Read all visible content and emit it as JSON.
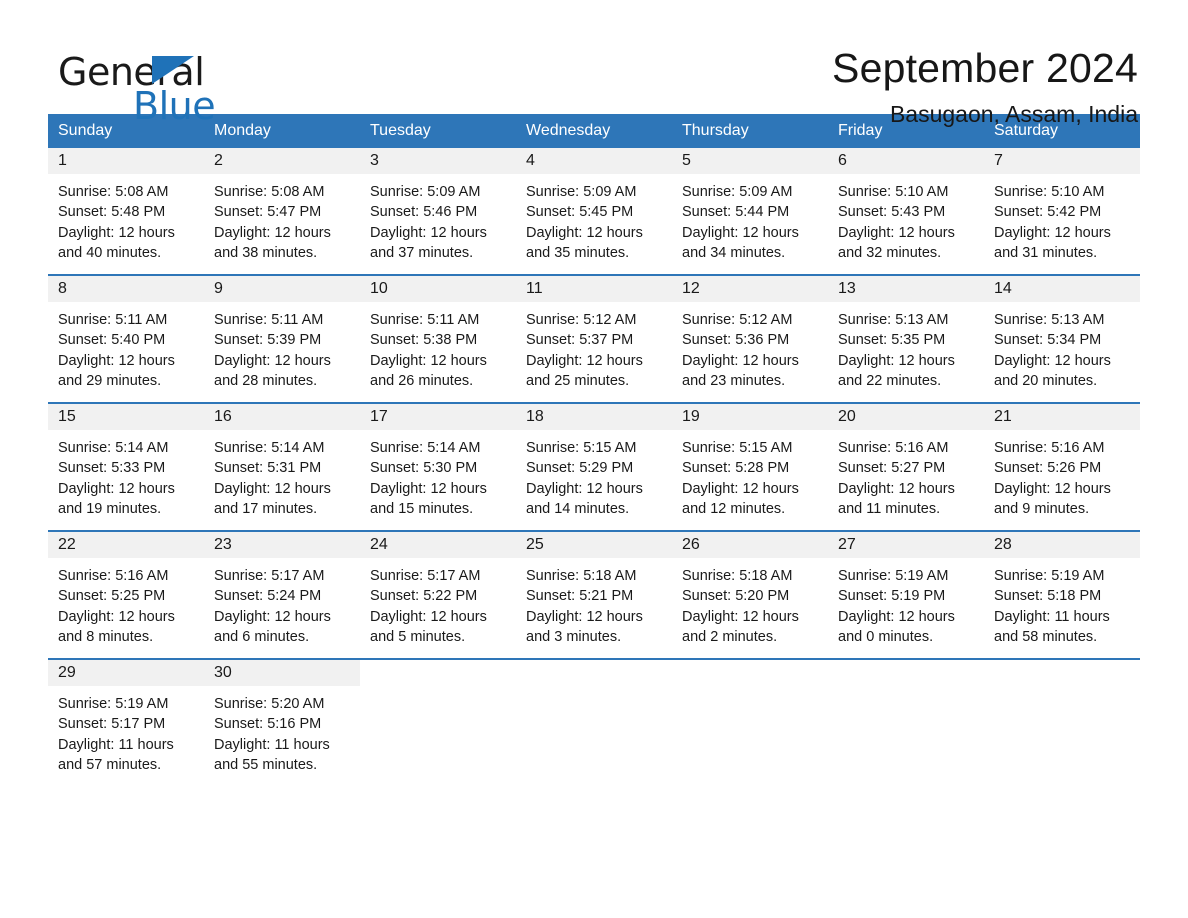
{
  "brand": {
    "name_part1": "General",
    "name_part2": "Blue",
    "triangle_color": "#1f72b8"
  },
  "header": {
    "title": "September 2024",
    "location": "Basugaon, Assam, India"
  },
  "theme": {
    "header_bg": "#2e76b8",
    "header_text": "#ffffff",
    "daynum_band": "#f1f1f1",
    "row_divider": "#2e76b8",
    "body_text": "#1a1a1a"
  },
  "weekdays": [
    "Sunday",
    "Monday",
    "Tuesday",
    "Wednesday",
    "Thursday",
    "Friday",
    "Saturday"
  ],
  "weeks": [
    [
      {
        "day": "1",
        "sunrise": "Sunrise: 5:08 AM",
        "sunset": "Sunset: 5:48 PM",
        "daylight1": "Daylight: 12 hours",
        "daylight2": "and 40 minutes."
      },
      {
        "day": "2",
        "sunrise": "Sunrise: 5:08 AM",
        "sunset": "Sunset: 5:47 PM",
        "daylight1": "Daylight: 12 hours",
        "daylight2": "and 38 minutes."
      },
      {
        "day": "3",
        "sunrise": "Sunrise: 5:09 AM",
        "sunset": "Sunset: 5:46 PM",
        "daylight1": "Daylight: 12 hours",
        "daylight2": "and 37 minutes."
      },
      {
        "day": "4",
        "sunrise": "Sunrise: 5:09 AM",
        "sunset": "Sunset: 5:45 PM",
        "daylight1": "Daylight: 12 hours",
        "daylight2": "and 35 minutes."
      },
      {
        "day": "5",
        "sunrise": "Sunrise: 5:09 AM",
        "sunset": "Sunset: 5:44 PM",
        "daylight1": "Daylight: 12 hours",
        "daylight2": "and 34 minutes."
      },
      {
        "day": "6",
        "sunrise": "Sunrise: 5:10 AM",
        "sunset": "Sunset: 5:43 PM",
        "daylight1": "Daylight: 12 hours",
        "daylight2": "and 32 minutes."
      },
      {
        "day": "7",
        "sunrise": "Sunrise: 5:10 AM",
        "sunset": "Sunset: 5:42 PM",
        "daylight1": "Daylight: 12 hours",
        "daylight2": "and 31 minutes."
      }
    ],
    [
      {
        "day": "8",
        "sunrise": "Sunrise: 5:11 AM",
        "sunset": "Sunset: 5:40 PM",
        "daylight1": "Daylight: 12 hours",
        "daylight2": "and 29 minutes."
      },
      {
        "day": "9",
        "sunrise": "Sunrise: 5:11 AM",
        "sunset": "Sunset: 5:39 PM",
        "daylight1": "Daylight: 12 hours",
        "daylight2": "and 28 minutes."
      },
      {
        "day": "10",
        "sunrise": "Sunrise: 5:11 AM",
        "sunset": "Sunset: 5:38 PM",
        "daylight1": "Daylight: 12 hours",
        "daylight2": "and 26 minutes."
      },
      {
        "day": "11",
        "sunrise": "Sunrise: 5:12 AM",
        "sunset": "Sunset: 5:37 PM",
        "daylight1": "Daylight: 12 hours",
        "daylight2": "and 25 minutes."
      },
      {
        "day": "12",
        "sunrise": "Sunrise: 5:12 AM",
        "sunset": "Sunset: 5:36 PM",
        "daylight1": "Daylight: 12 hours",
        "daylight2": "and 23 minutes."
      },
      {
        "day": "13",
        "sunrise": "Sunrise: 5:13 AM",
        "sunset": "Sunset: 5:35 PM",
        "daylight1": "Daylight: 12 hours",
        "daylight2": "and 22 minutes."
      },
      {
        "day": "14",
        "sunrise": "Sunrise: 5:13 AM",
        "sunset": "Sunset: 5:34 PM",
        "daylight1": "Daylight: 12 hours",
        "daylight2": "and 20 minutes."
      }
    ],
    [
      {
        "day": "15",
        "sunrise": "Sunrise: 5:14 AM",
        "sunset": "Sunset: 5:33 PM",
        "daylight1": "Daylight: 12 hours",
        "daylight2": "and 19 minutes."
      },
      {
        "day": "16",
        "sunrise": "Sunrise: 5:14 AM",
        "sunset": "Sunset: 5:31 PM",
        "daylight1": "Daylight: 12 hours",
        "daylight2": "and 17 minutes."
      },
      {
        "day": "17",
        "sunrise": "Sunrise: 5:14 AM",
        "sunset": "Sunset: 5:30 PM",
        "daylight1": "Daylight: 12 hours",
        "daylight2": "and 15 minutes."
      },
      {
        "day": "18",
        "sunrise": "Sunrise: 5:15 AM",
        "sunset": "Sunset: 5:29 PM",
        "daylight1": "Daylight: 12 hours",
        "daylight2": "and 14 minutes."
      },
      {
        "day": "19",
        "sunrise": "Sunrise: 5:15 AM",
        "sunset": "Sunset: 5:28 PM",
        "daylight1": "Daylight: 12 hours",
        "daylight2": "and 12 minutes."
      },
      {
        "day": "20",
        "sunrise": "Sunrise: 5:16 AM",
        "sunset": "Sunset: 5:27 PM",
        "daylight1": "Daylight: 12 hours",
        "daylight2": "and 11 minutes."
      },
      {
        "day": "21",
        "sunrise": "Sunrise: 5:16 AM",
        "sunset": "Sunset: 5:26 PM",
        "daylight1": "Daylight: 12 hours",
        "daylight2": "and 9 minutes."
      }
    ],
    [
      {
        "day": "22",
        "sunrise": "Sunrise: 5:16 AM",
        "sunset": "Sunset: 5:25 PM",
        "daylight1": "Daylight: 12 hours",
        "daylight2": "and 8 minutes."
      },
      {
        "day": "23",
        "sunrise": "Sunrise: 5:17 AM",
        "sunset": "Sunset: 5:24 PM",
        "daylight1": "Daylight: 12 hours",
        "daylight2": "and 6 minutes."
      },
      {
        "day": "24",
        "sunrise": "Sunrise: 5:17 AM",
        "sunset": "Sunset: 5:22 PM",
        "daylight1": "Daylight: 12 hours",
        "daylight2": "and 5 minutes."
      },
      {
        "day": "25",
        "sunrise": "Sunrise: 5:18 AM",
        "sunset": "Sunset: 5:21 PM",
        "daylight1": "Daylight: 12 hours",
        "daylight2": "and 3 minutes."
      },
      {
        "day": "26",
        "sunrise": "Sunrise: 5:18 AM",
        "sunset": "Sunset: 5:20 PM",
        "daylight1": "Daylight: 12 hours",
        "daylight2": "and 2 minutes."
      },
      {
        "day": "27",
        "sunrise": "Sunrise: 5:19 AM",
        "sunset": "Sunset: 5:19 PM",
        "daylight1": "Daylight: 12 hours",
        "daylight2": "and 0 minutes."
      },
      {
        "day": "28",
        "sunrise": "Sunrise: 5:19 AM",
        "sunset": "Sunset: 5:18 PM",
        "daylight1": "Daylight: 11 hours",
        "daylight2": "and 58 minutes."
      }
    ],
    [
      {
        "day": "29",
        "sunrise": "Sunrise: 5:19 AM",
        "sunset": "Sunset: 5:17 PM",
        "daylight1": "Daylight: 11 hours",
        "daylight2": "and 57 minutes."
      },
      {
        "day": "30",
        "sunrise": "Sunrise: 5:20 AM",
        "sunset": "Sunset: 5:16 PM",
        "daylight1": "Daylight: 11 hours",
        "daylight2": "and 55 minutes."
      },
      {
        "day": "",
        "sunrise": "",
        "sunset": "",
        "daylight1": "",
        "daylight2": ""
      },
      {
        "day": "",
        "sunrise": "",
        "sunset": "",
        "daylight1": "",
        "daylight2": ""
      },
      {
        "day": "",
        "sunrise": "",
        "sunset": "",
        "daylight1": "",
        "daylight2": ""
      },
      {
        "day": "",
        "sunrise": "",
        "sunset": "",
        "daylight1": "",
        "daylight2": ""
      },
      {
        "day": "",
        "sunrise": "",
        "sunset": "",
        "daylight1": "",
        "daylight2": ""
      }
    ]
  ]
}
